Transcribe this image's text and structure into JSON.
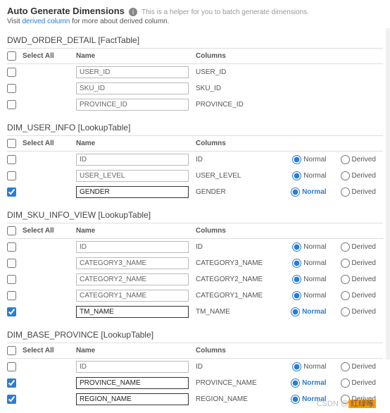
{
  "header": {
    "title": "Auto Generate Dimensions",
    "hint": "This is a helper for you to batch generate dimensions.",
    "sub_pre": "Visit ",
    "sub_link": "derived column",
    "sub_post": " for more about derived column."
  },
  "labels": {
    "select_all": "Select All",
    "name": "Name",
    "columns": "Columns",
    "normal": "Normal",
    "derived": "Derived"
  },
  "tables": [
    {
      "title": "DWD_ORDER_DETAIL [FactTable]",
      "has_radio": false,
      "rows": [
        {
          "checked": false,
          "name": "USER_ID",
          "col": "USER_ID",
          "sel": false
        },
        {
          "checked": false,
          "name": "SKU_ID",
          "col": "SKU_ID",
          "sel": false
        },
        {
          "checked": false,
          "name": "PROVINCE_ID",
          "col": "PROVINCE_ID",
          "sel": false
        }
      ]
    },
    {
      "title": "DIM_USER_INFO [LookupTable]",
      "has_radio": true,
      "rows": [
        {
          "checked": false,
          "name": "ID",
          "col": "ID",
          "sel": false,
          "radio": "normal"
        },
        {
          "checked": false,
          "name": "USER_LEVEL",
          "col": "USER_LEVEL",
          "sel": false,
          "radio": "normal"
        },
        {
          "checked": true,
          "name": "GENDER",
          "col": "GENDER",
          "sel": true,
          "radio": "normal"
        }
      ]
    },
    {
      "title": "DIM_SKU_INFO_VIEW [LookupTable]",
      "has_radio": true,
      "rows": [
        {
          "checked": false,
          "name": "ID",
          "col": "ID",
          "sel": false,
          "radio": "normal"
        },
        {
          "checked": false,
          "name": "CATEGORY3_NAME",
          "col": "CATEGORY3_NAME",
          "sel": false,
          "radio": "normal"
        },
        {
          "checked": false,
          "name": "CATEGORY2_NAME",
          "col": "CATEGORY2_NAME",
          "sel": false,
          "radio": "normal"
        },
        {
          "checked": false,
          "name": "CATEGORY1_NAME",
          "col": "CATEGORY1_NAME",
          "sel": false,
          "radio": "normal"
        },
        {
          "checked": true,
          "name": "TM_NAME",
          "col": "TM_NAME",
          "sel": true,
          "radio": "normal"
        }
      ]
    },
    {
      "title": "DIM_BASE_PROVINCE [LookupTable]",
      "has_radio": true,
      "rows": [
        {
          "checked": false,
          "name": "ID",
          "col": "ID",
          "sel": false,
          "radio": "normal"
        },
        {
          "checked": true,
          "name": "PROVINCE_NAME",
          "col": "PROVINCE_NAME",
          "sel": true,
          "radio": "normal"
        },
        {
          "checked": true,
          "name": "REGION_NAME",
          "col": "REGION_NAME",
          "sel": true,
          "radio": "normal"
        }
      ]
    }
  ],
  "watermark": {
    "pre": "CSDN @",
    "hl": "红绿啄"
  }
}
